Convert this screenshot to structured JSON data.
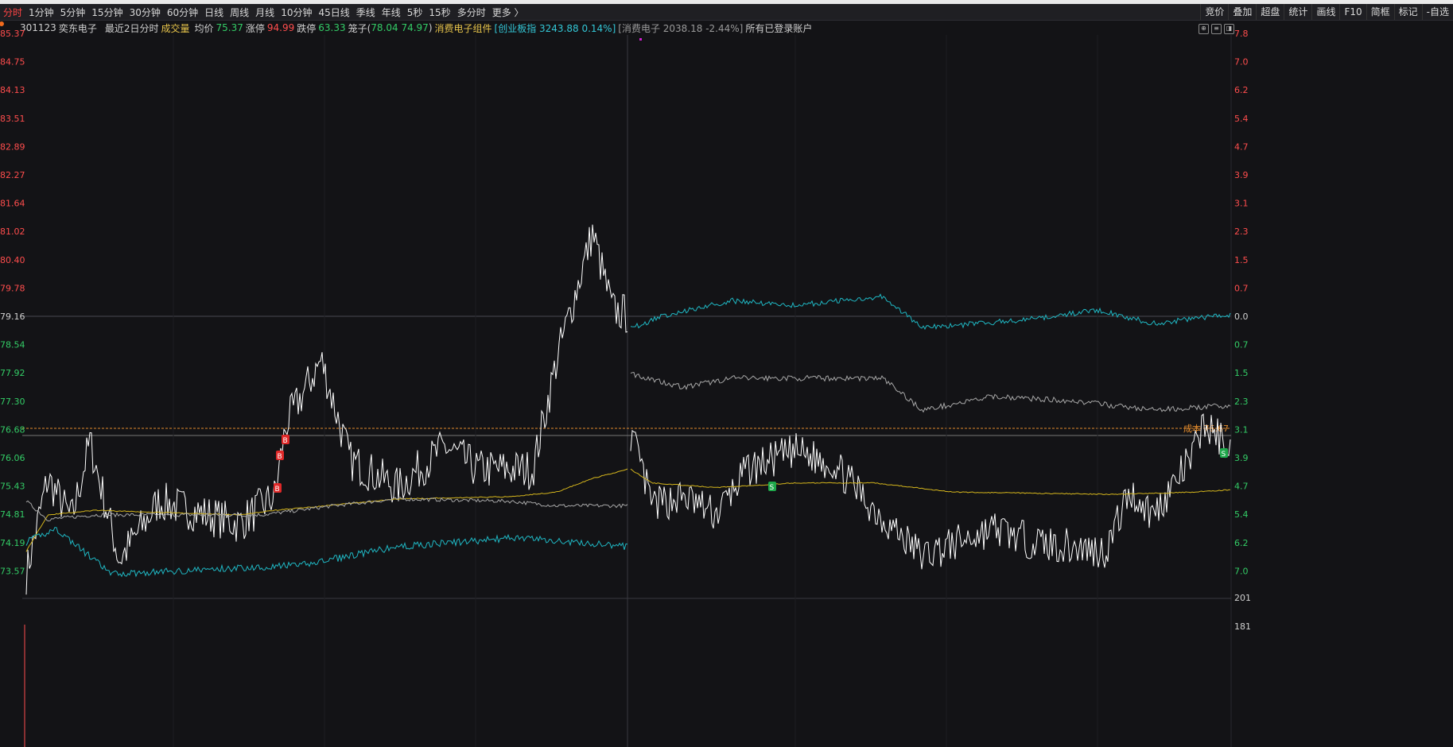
{
  "toolbar": {
    "periods": [
      "分时",
      "1分钟",
      "5分钟",
      "15分钟",
      "30分钟",
      "60分钟",
      "日线",
      "周线",
      "月线",
      "10分钟",
      "45日线",
      "季线",
      "年线",
      "5秒",
      "15秒",
      "多分时",
      "更多 〉"
    ],
    "active_period": "分时",
    "right_tools": [
      "竞价",
      "叠加",
      "超盘",
      "统计",
      "画线",
      "F10",
      "简框",
      "标记",
      "-自选"
    ]
  },
  "info": {
    "code": "301123",
    "name": "奕东电子",
    "mode": "最近2日分时",
    "volume_label": "成交量",
    "avg_label": "均价",
    "avg_value": "75.37",
    "limit_up_label": "涨停",
    "limit_up_value": "94.99",
    "limit_down_label": "跌停",
    "limit_down_value": "63.33",
    "cage_label": "笼子(",
    "cage_values": "78.04 74.97",
    "cage_close": ")",
    "sector": "消费电子组件",
    "index_text": "[创业板指 3243.88 0.14%]",
    "sector_index_text": "[消费电子 2038.18 -2.44%]",
    "account": "所有已登录账户"
  },
  "price_axis": [
    "85.37",
    "84.75",
    "84.13",
    "83.51",
    "82.89",
    "82.27",
    "81.64",
    "81.02",
    "80.40",
    "79.78",
    "79.16",
    "78.54",
    "77.92",
    "77.30",
    "76.68",
    "76.06",
    "75.43",
    "74.81",
    "74.19",
    "73.57"
  ],
  "prev_close": "79.16",
  "pct_axis": [
    "7.8",
    "7.0",
    "6.2",
    "5.4",
    "4.7",
    "3.9",
    "3.1",
    "2.3",
    "1.5",
    "0.7",
    "0.0",
    "0.7",
    "1.5",
    "2.3",
    "3.1",
    "3.9",
    "4.7",
    "5.4",
    "6.2",
    "7.0"
  ],
  "volume_axis": [
    "201",
    "181"
  ],
  "cost_label": "成本 76.67",
  "markers": {
    "buy": "B",
    "sell": "S"
  },
  "colors": {
    "price_line": "#ffffff",
    "avg_line": "#d4b51c",
    "index_line": "#1fb8c4",
    "sector_line": "#a8a8a8",
    "cost_line": "#e08a2c",
    "up": "#ff4d4d",
    "down": "#33cc66"
  }
}
